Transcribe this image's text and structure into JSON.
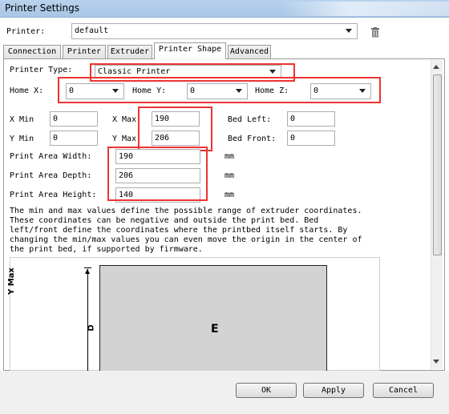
{
  "window": {
    "title": "Printer Settings"
  },
  "printer": {
    "label": "Printer:",
    "value": "default"
  },
  "tabs": [
    {
      "label": "Connection"
    },
    {
      "label": "Printer"
    },
    {
      "label": "Extruder"
    },
    {
      "label": "Printer Shape"
    },
    {
      "label": "Advanced"
    }
  ],
  "active_tab": "Printer Shape",
  "shape": {
    "printer_type_label": "Printer Type:",
    "printer_type_value": "Classic Printer",
    "home_x_label": "Home X:",
    "home_x_value": "0",
    "home_y_label": "Home Y:",
    "home_y_value": "0",
    "home_z_label": "Home Z:",
    "home_z_value": "0",
    "x_min_label": "X Min",
    "x_min_value": "0",
    "x_max_label": "X Max",
    "x_max_value": "190",
    "bed_left_label": "Bed Left:",
    "bed_left_value": "0",
    "y_min_label": "Y Min",
    "y_min_value": "0",
    "y_max_label": "Y Max",
    "y_max_value": "206",
    "bed_front_label": "Bed Front:",
    "bed_front_value": "0",
    "width_label": "Print Area Width:",
    "width_value": "190",
    "width_unit": "mm",
    "depth_label": "Print Area Depth:",
    "depth_value": "206",
    "depth_unit": "mm",
    "height_label": "Print Area Height:",
    "height_value": "140",
    "height_unit": "mm",
    "description": "The min and max values define the possible range of extruder coordinates.\nThese coordinates can be negative and outside the print bed. Bed\nleft/front define the coordinates where the printbed itself starts. By\nchanging the min/max values you can even move the origin in the center of\nthe print bed, if supported by firmware."
  },
  "diagram": {
    "y_axis_label": "Y Max",
    "d_label": "D",
    "e_label": "E"
  },
  "buttons": {
    "ok": "OK",
    "apply": "Apply",
    "cancel": "Cancel"
  },
  "colors": {
    "highlight": "#ee3333",
    "titlebar": "#b8d2ec",
    "diagram_fill": "#d3d3d3"
  }
}
